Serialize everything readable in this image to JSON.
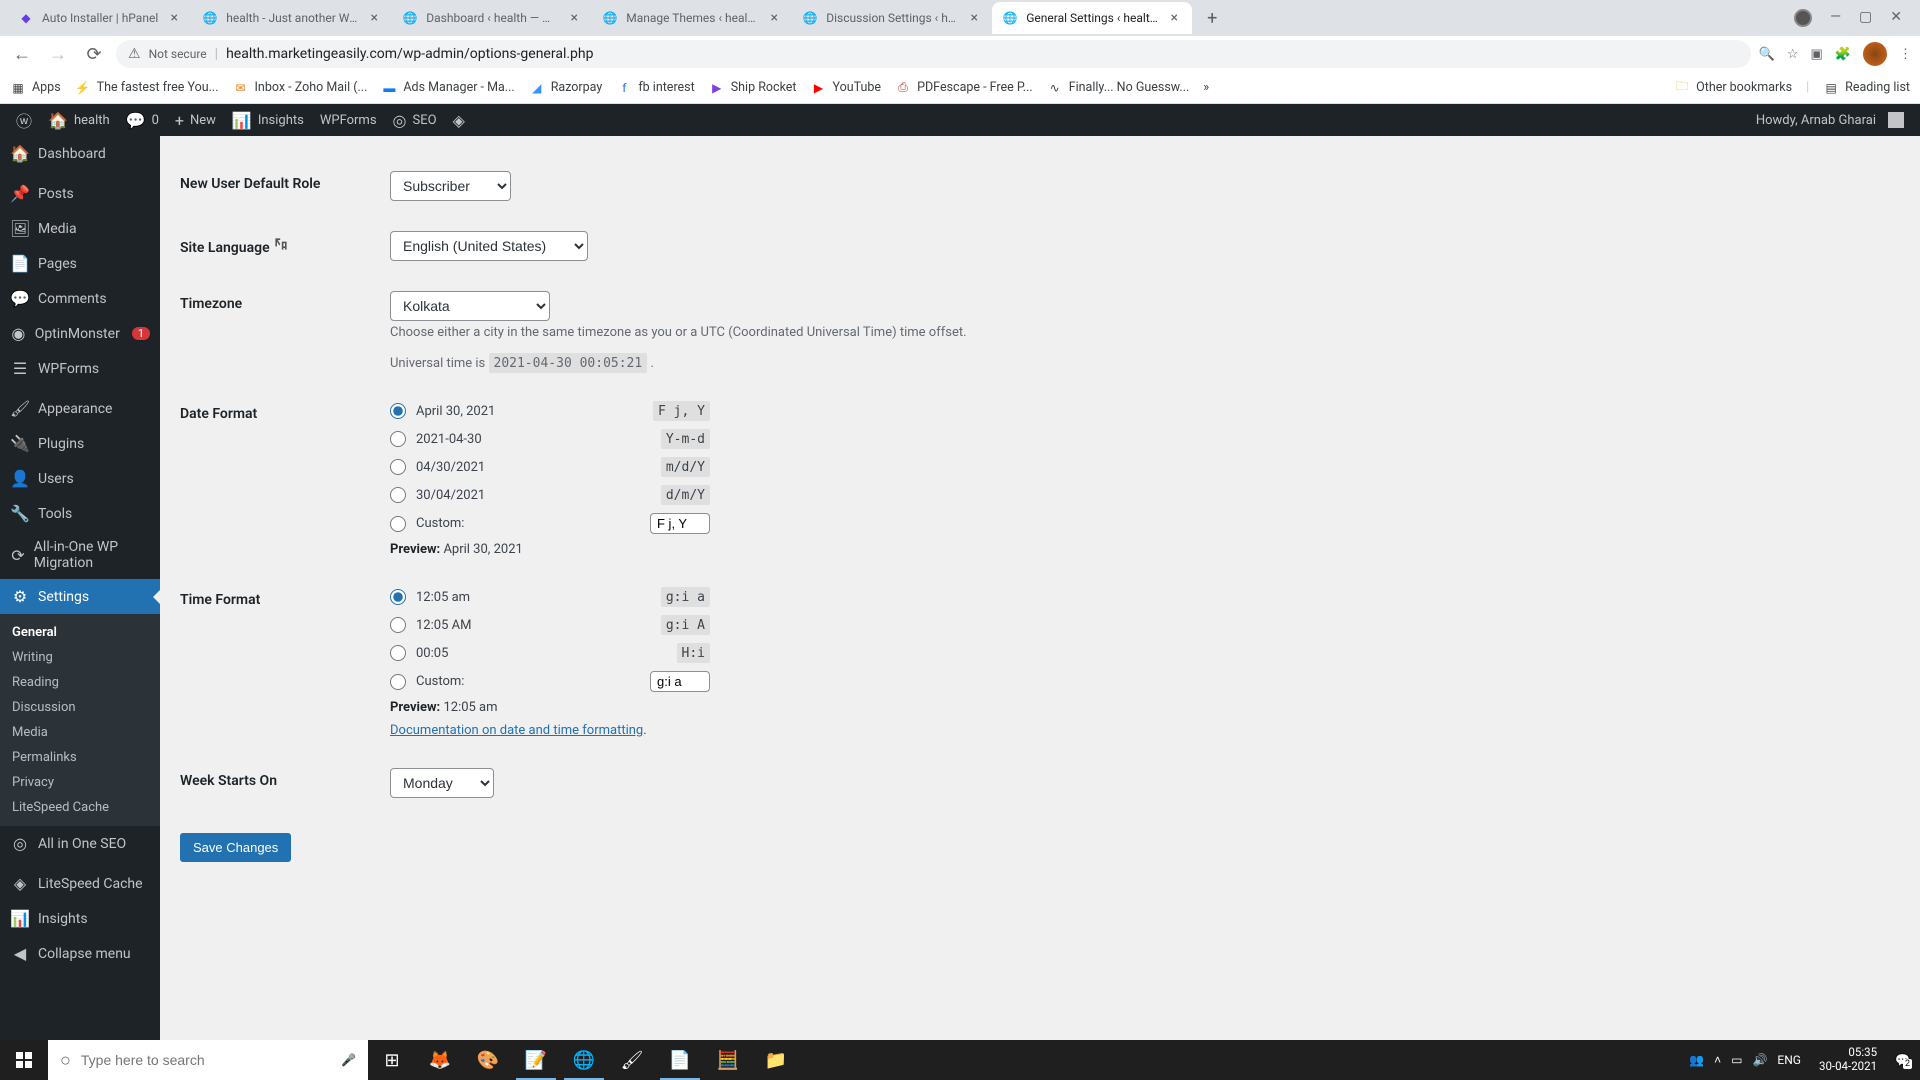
{
  "chrome": {
    "tabs": [
      {
        "title": "Auto Installer | hPanel"
      },
      {
        "title": "health - Just another WordP"
      },
      {
        "title": "Dashboard ‹ health — Wor"
      },
      {
        "title": "Manage Themes ‹ health —"
      },
      {
        "title": "Discussion Settings ‹ health"
      },
      {
        "title": "General Settings ‹ health —"
      }
    ],
    "address": {
      "secure_label": "Not secure",
      "url": "health.marketingeasily.com/wp-admin/options-general.php"
    },
    "bookmarks": [
      {
        "label": "Apps"
      },
      {
        "label": "The fastest free You..."
      },
      {
        "label": "Inbox - Zoho Mail (..."
      },
      {
        "label": "Ads Manager - Ma..."
      },
      {
        "label": "Razorpay"
      },
      {
        "label": "fb interest"
      },
      {
        "label": "Ship Rocket"
      },
      {
        "label": "YouTube"
      },
      {
        "label": "PDFescape - Free P..."
      },
      {
        "label": "Finally... No Guessw..."
      }
    ],
    "other_bookmarks": "Other bookmarks",
    "reading_list": "Reading list"
  },
  "wpbar": {
    "site": "health",
    "comments": "0",
    "new": "New",
    "insights": "Insights",
    "wpforms": "WPForms",
    "seo": "SEO",
    "howdy": "Howdy, Arnab Gharai"
  },
  "sidebar": {
    "dashboard": "Dashboard",
    "posts": "Posts",
    "media": "Media",
    "pages": "Pages",
    "comments": "Comments",
    "optinmonster": "OptinMonster",
    "optinmonster_badge": "1",
    "wpforms": "WPForms",
    "appearance": "Appearance",
    "plugins": "Plugins",
    "users": "Users",
    "tools": "Tools",
    "migration": "All-in-One WP Migration",
    "settings": "Settings",
    "submenu": {
      "general": "General",
      "writing": "Writing",
      "reading": "Reading",
      "discussion": "Discussion",
      "media": "Media",
      "permalinks": "Permalinks",
      "privacy": "Privacy",
      "litespeed": "LiteSpeed Cache"
    },
    "aioseo": "All in One SEO",
    "litespeed": "LiteSpeed Cache",
    "insights": "Insights",
    "collapse": "Collapse menu"
  },
  "form": {
    "new_user_role": {
      "label": "New User Default Role",
      "value": "Subscriber"
    },
    "site_language": {
      "label": "Site Language",
      "value": "English (United States)"
    },
    "timezone": {
      "label": "Timezone",
      "value": "Kolkata",
      "description": "Choose either a city in the same timezone as you or a UTC (Coordinated Universal Time) time offset.",
      "utc_label": "Universal time is",
      "utc_value": "2021-04-30 00:05:21"
    },
    "date_format": {
      "label": "Date Format",
      "options": [
        {
          "display": "April 30, 2021",
          "code": "F j, Y"
        },
        {
          "display": "2021-04-30",
          "code": "Y-m-d"
        },
        {
          "display": "04/30/2021",
          "code": "m/d/Y"
        },
        {
          "display": "30/04/2021",
          "code": "d/m/Y"
        }
      ],
      "custom_label": "Custom:",
      "custom_value": "F j, Y",
      "preview_label": "Preview:",
      "preview_value": "April 30, 2021"
    },
    "time_format": {
      "label": "Time Format",
      "options": [
        {
          "display": "12:05 am",
          "code": "g:i a"
        },
        {
          "display": "12:05 AM",
          "code": "g:i A"
        },
        {
          "display": "00:05",
          "code": "H:i"
        }
      ],
      "custom_label": "Custom:",
      "custom_value": "g:i a",
      "preview_label": "Preview:",
      "preview_value": "12:05 am",
      "doc_link": "Documentation on date and time formatting"
    },
    "week_starts": {
      "label": "Week Starts On",
      "value": "Monday"
    },
    "save": "Save Changes"
  },
  "taskbar": {
    "search_placeholder": "Type here to search",
    "lang": "ENG",
    "time": "05:35",
    "date": "30-04-2021",
    "notif": "2"
  }
}
